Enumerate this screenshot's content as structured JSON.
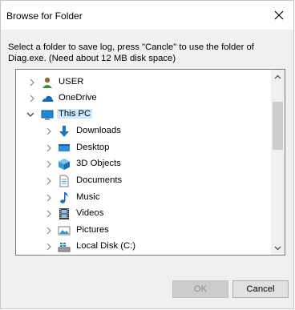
{
  "window": {
    "title": "Browse for Folder"
  },
  "message": "Select a folder to save log, press \"Cancle\" to use the folder of Diag.exe. (Need about 12 MB disk space)",
  "tree": {
    "items": [
      {
        "label": "USER",
        "icon": "user-icon",
        "expanded": false
      },
      {
        "label": "OneDrive",
        "icon": "onedrive-cloud-icon",
        "expanded": false
      },
      {
        "label": "This PC",
        "icon": "this-pc-icon",
        "expanded": true,
        "selected": true
      },
      {
        "label": "Downloads",
        "icon": "downloads-icon",
        "expanded": false
      },
      {
        "label": "Desktop",
        "icon": "desktop-icon",
        "expanded": false
      },
      {
        "label": "3D Objects",
        "icon": "3d-objects-icon",
        "expanded": false
      },
      {
        "label": "Documents",
        "icon": "documents-icon",
        "expanded": false
      },
      {
        "label": "Music",
        "icon": "music-icon",
        "expanded": false
      },
      {
        "label": "Videos",
        "icon": "videos-icon",
        "expanded": false
      },
      {
        "label": "Pictures",
        "icon": "pictures-icon",
        "expanded": false
      },
      {
        "label": "Local Disk (C:)",
        "icon": "local-disk-icon",
        "expanded": false
      }
    ]
  },
  "buttons": {
    "ok": "OK",
    "cancel": "Cancel"
  }
}
